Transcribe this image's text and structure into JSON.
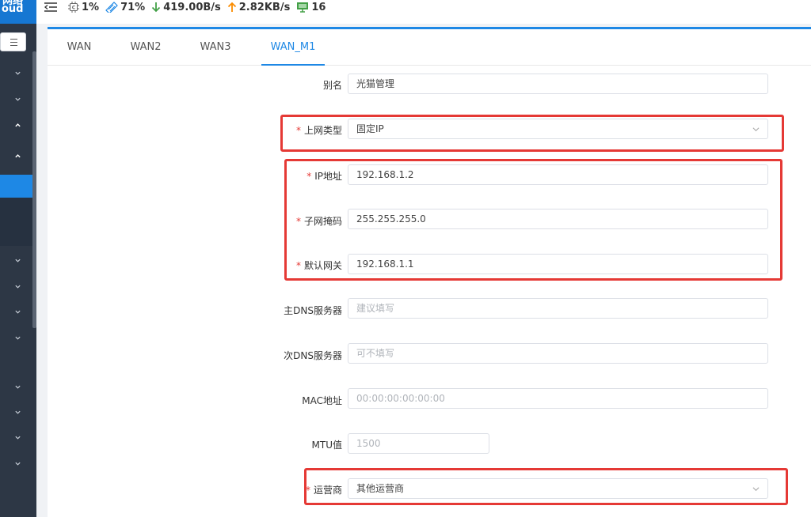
{
  "app": {
    "logo_line1": "网络",
    "logo_line2": "oud"
  },
  "topbar": {
    "cpu": "1%",
    "mem": "71%",
    "down": "419.00B/s",
    "up": "2.82KB/s",
    "devices": "16"
  },
  "tabs": [
    {
      "label": "WAN"
    },
    {
      "label": "WAN2"
    },
    {
      "label": "WAN3"
    },
    {
      "label": "WAN_M1"
    }
  ],
  "form": {
    "alias": {
      "label": "别名",
      "value": "光猫管理"
    },
    "conn_type": {
      "label": "上网类型",
      "value": "固定IP"
    },
    "ip": {
      "label": "IP地址",
      "value": "192.168.1.2"
    },
    "mask": {
      "label": "子网掩码",
      "value": "255.255.255.0"
    },
    "gateway": {
      "label": "默认网关",
      "value": "192.168.1.1"
    },
    "dns1": {
      "label": "主DNS服务器",
      "placeholder": "建议填写"
    },
    "dns2": {
      "label": "次DNS服务器",
      "placeholder": "可不填写"
    },
    "mac": {
      "label": "MAC地址",
      "placeholder": "00:00:00:00:00:00"
    },
    "mtu": {
      "label": "MTU值",
      "placeholder": "1500"
    },
    "isp": {
      "label": "运营商",
      "value": "其他运营商"
    }
  },
  "colors": {
    "accent": "#1e88e5",
    "required": "#e53935",
    "sidebar": "#2d3745"
  }
}
